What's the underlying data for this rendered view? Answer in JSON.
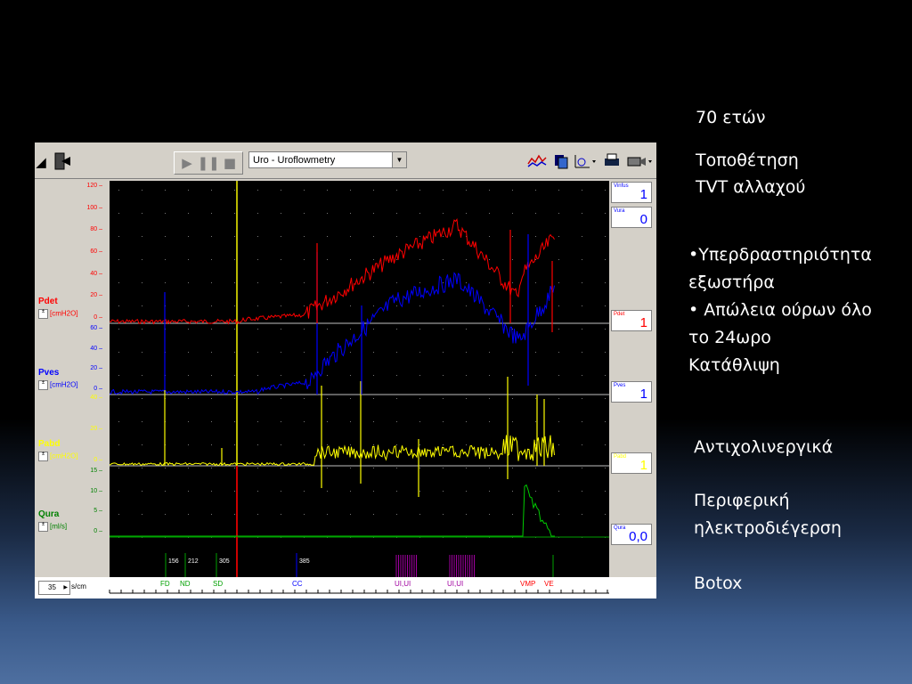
{
  "app": {
    "mode_select": "Uro - Uroflowmetry",
    "speed_value": "35",
    "speed_unit": "s/cm"
  },
  "channels": [
    {
      "name": "Pdet",
      "unit": "[cmH2O]",
      "color": "#ff0000"
    },
    {
      "name": "Pves",
      "unit": "[cmH2O]",
      "color": "#0000ff"
    },
    {
      "name": "Pabd",
      "unit": "[cmH2O]",
      "color": "#ffff00"
    },
    {
      "name": "Qura",
      "unit": "[ml/s]",
      "color": "#008000"
    }
  ],
  "ticks": {
    "pdet": [
      "120",
      "100",
      "80",
      "60",
      "40",
      "20",
      "0"
    ],
    "pves": [
      "60",
      "40",
      "20",
      "0"
    ],
    "pabd": [
      "40",
      "20",
      "0"
    ],
    "qura": [
      "15",
      "10",
      "5",
      "0"
    ]
  },
  "readouts": [
    {
      "name": "Vinfus",
      "value": "1",
      "color": "#0000ff"
    },
    {
      "name": "Vura",
      "value": "0",
      "color": "#0000ff"
    },
    {
      "name": "Pdet",
      "value": "1",
      "color": "#ff0000"
    },
    {
      "name": "Pves",
      "value": "1",
      "color": "#0000ff"
    },
    {
      "name": "Pabd",
      "value": "1",
      "color": "#ffff00"
    },
    {
      "name": "Qura",
      "value": "0,0",
      "color": "#0000ff"
    }
  ],
  "markers": [
    {
      "label": "156",
      "event": "FD"
    },
    {
      "label": "212",
      "event": "ND"
    },
    {
      "label": "305",
      "event": "SD"
    },
    {
      "label": "385",
      "event": "CC"
    }
  ],
  "events_bottom": [
    "FD",
    "ND",
    "SD",
    "CC",
    "UI,UI",
    "UI,UI",
    "VMP",
    "VE"
  ],
  "slide": {
    "age": "70 ετών",
    "placement_line1": "Τοποθέτηση",
    "placement_line2": "TVT αλλαχού",
    "bullet1_line1": "•Υπερδραστηριότητα",
    "bullet1_line2": "εξωστήρα",
    "bullet2_line1": "• Απώλεια ούρων όλο",
    "bullet2_line2": "το 24ωρο",
    "bullet3": "Κατάθλιψη",
    "treatment1": "Αντιχολινεργικά",
    "treatment2_line1": "Περιφερική",
    "treatment2_line2": "ηλεκτροδιέγερση",
    "treatment3": "Botox"
  }
}
